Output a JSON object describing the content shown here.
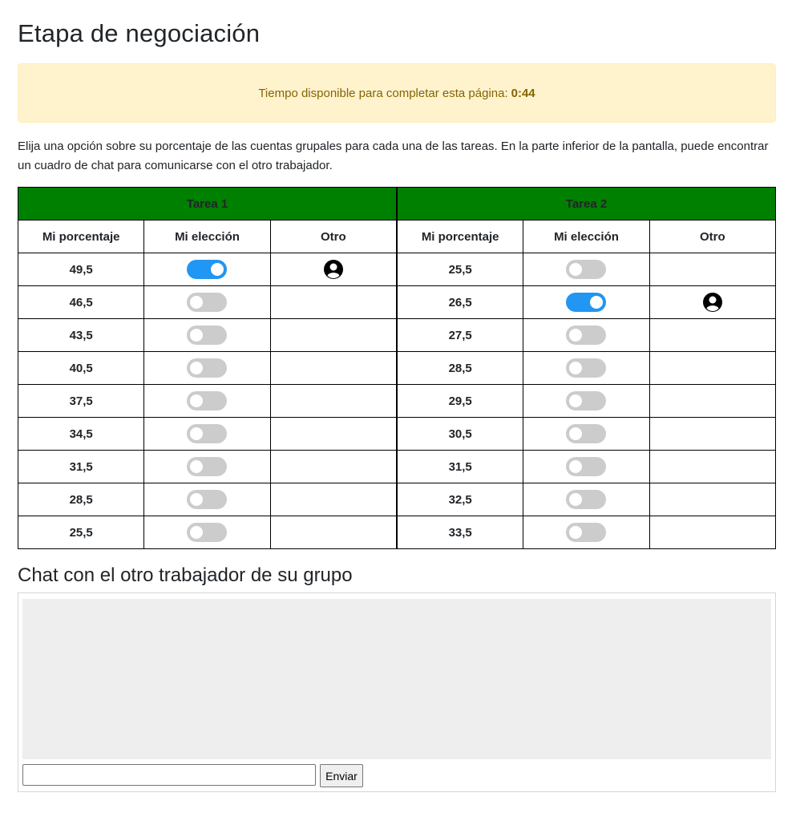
{
  "page_title": "Etapa de negociación",
  "timer": {
    "label": "Tiempo disponible para completar esta página:",
    "value": "0:44"
  },
  "instructions": "Elija una opción sobre su porcentaje de las cuentas grupales para cada una de las tareas. En la parte inferior de la pantalla, puede encontrar un cuadro de chat para comunicarse con el otro trabajador.",
  "columns": {
    "pct": "Mi porcentaje",
    "choice": "Mi elección",
    "other": "Otro"
  },
  "tasks": [
    {
      "title": "Tarea 1",
      "rows": [
        {
          "pct": "49,5",
          "mine": true,
          "other": true
        },
        {
          "pct": "46,5",
          "mine": false,
          "other": false
        },
        {
          "pct": "43,5",
          "mine": false,
          "other": false
        },
        {
          "pct": "40,5",
          "mine": false,
          "other": false
        },
        {
          "pct": "37,5",
          "mine": false,
          "other": false
        },
        {
          "pct": "34,5",
          "mine": false,
          "other": false
        },
        {
          "pct": "31,5",
          "mine": false,
          "other": false
        },
        {
          "pct": "28,5",
          "mine": false,
          "other": false
        },
        {
          "pct": "25,5",
          "mine": false,
          "other": false
        }
      ]
    },
    {
      "title": "Tarea 2",
      "rows": [
        {
          "pct": "25,5",
          "mine": false,
          "other": false
        },
        {
          "pct": "26,5",
          "mine": true,
          "other": true
        },
        {
          "pct": "27,5",
          "mine": false,
          "other": false
        },
        {
          "pct": "28,5",
          "mine": false,
          "other": false
        },
        {
          "pct": "29,5",
          "mine": false,
          "other": false
        },
        {
          "pct": "30,5",
          "mine": false,
          "other": false
        },
        {
          "pct": "31,5",
          "mine": false,
          "other": false
        },
        {
          "pct": "32,5",
          "mine": false,
          "other": false
        },
        {
          "pct": "33,5",
          "mine": false,
          "other": false
        }
      ]
    }
  ],
  "chat": {
    "heading": "Chat con el otro trabajador de su grupo",
    "input_value": "",
    "send_label": "Enviar"
  },
  "colors": {
    "header_green": "#008000",
    "toggle_on": "#2196f3",
    "toggle_off": "#cccccc",
    "alert_bg": "#fff3cd",
    "alert_text": "#856404"
  },
  "icons": {
    "other_marker": "user-circle-icon"
  }
}
